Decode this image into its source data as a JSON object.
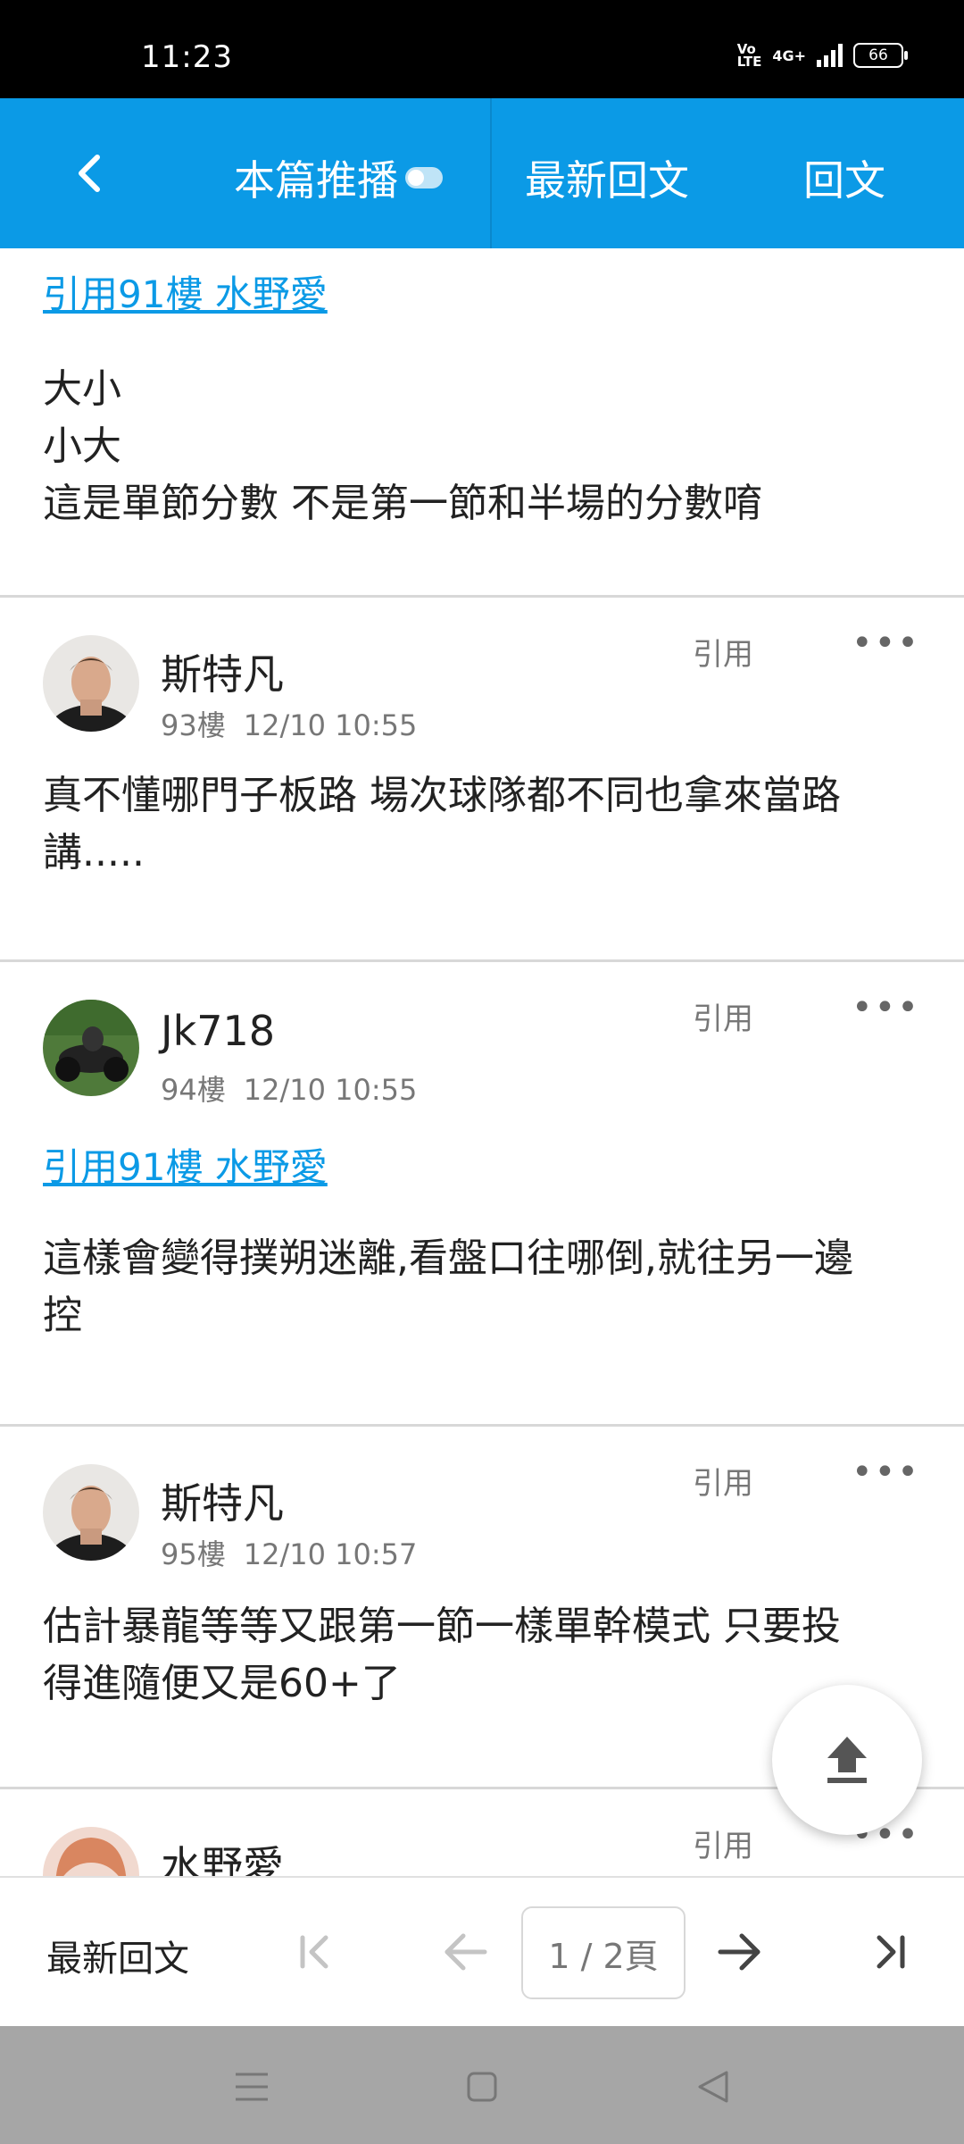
{
  "status_bar": {
    "time": "11:23",
    "volte": "Vo\nLTE",
    "network": "4G+",
    "battery": "66"
  },
  "header": {
    "tab_push": "本篇推播",
    "tab_latest": "最新回文",
    "tab_reply": "回文"
  },
  "top_fragment": {
    "quote": "引用91樓 水野愛",
    "lines": [
      "大小",
      "小大",
      "這是單節分數 不是第一節和半場的分數唷"
    ]
  },
  "posts": [
    {
      "username": "斯特凡",
      "floor": "93樓",
      "time": "12/10 10:55",
      "quote_label": "引用",
      "body_lines": [
        "真不懂哪門子板路 場次球隊都不同也拿來當路",
        "講....."
      ]
    },
    {
      "username": "Jk718",
      "floor": "94樓",
      "time": "12/10 10:55",
      "quote_label": "引用",
      "quote": "引用91樓 水野愛",
      "body_lines": [
        "這樣會變得撲朔迷離,看盤口往哪倒,就往另一邊",
        "控"
      ]
    },
    {
      "username": "斯特凡",
      "floor": "95樓",
      "time": "12/10 10:57",
      "quote_label": "引用",
      "body_lines": [
        "估計暴龍等等又跟第一節一樣單幹模式 只要投",
        "得進隨便又是60+了"
      ]
    },
    {
      "username": "水野愛",
      "quote_label": "引用"
    }
  ],
  "more_label": "•••",
  "pagination": {
    "latest_label": "最新回文",
    "page_indicator": "1 / 2頁"
  }
}
